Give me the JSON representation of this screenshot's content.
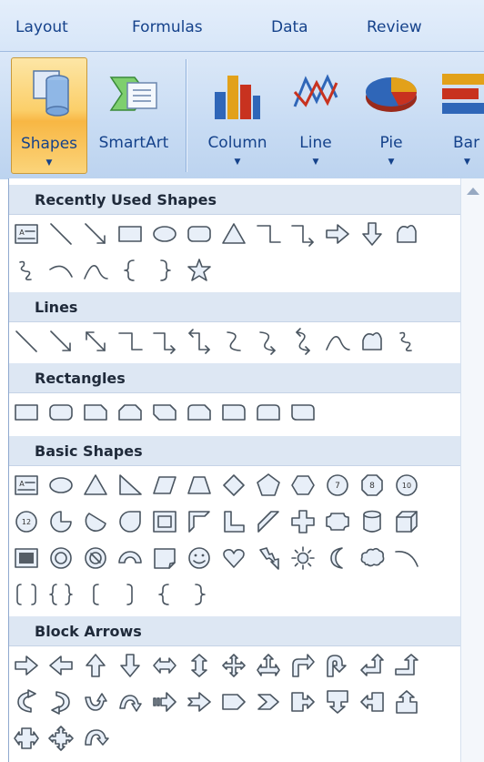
{
  "tabs": [
    "Layout",
    "Formulas",
    "Data",
    "Review"
  ],
  "ribbon": {
    "shapes_label": "Shapes",
    "smartart_label": "SmartArt",
    "column_label": "Column",
    "line_label": "Line",
    "pie_label": "Pie",
    "bar_label": "Bar"
  },
  "gallery": {
    "sections": {
      "recent": "Recently Used Shapes",
      "lines": "Lines",
      "rectangles": "Rectangles",
      "basic": "Basic Shapes",
      "block": "Block Arrows"
    },
    "badges": {
      "seven": "7",
      "eight": "8",
      "ten": "10",
      "twelve": "12"
    }
  }
}
